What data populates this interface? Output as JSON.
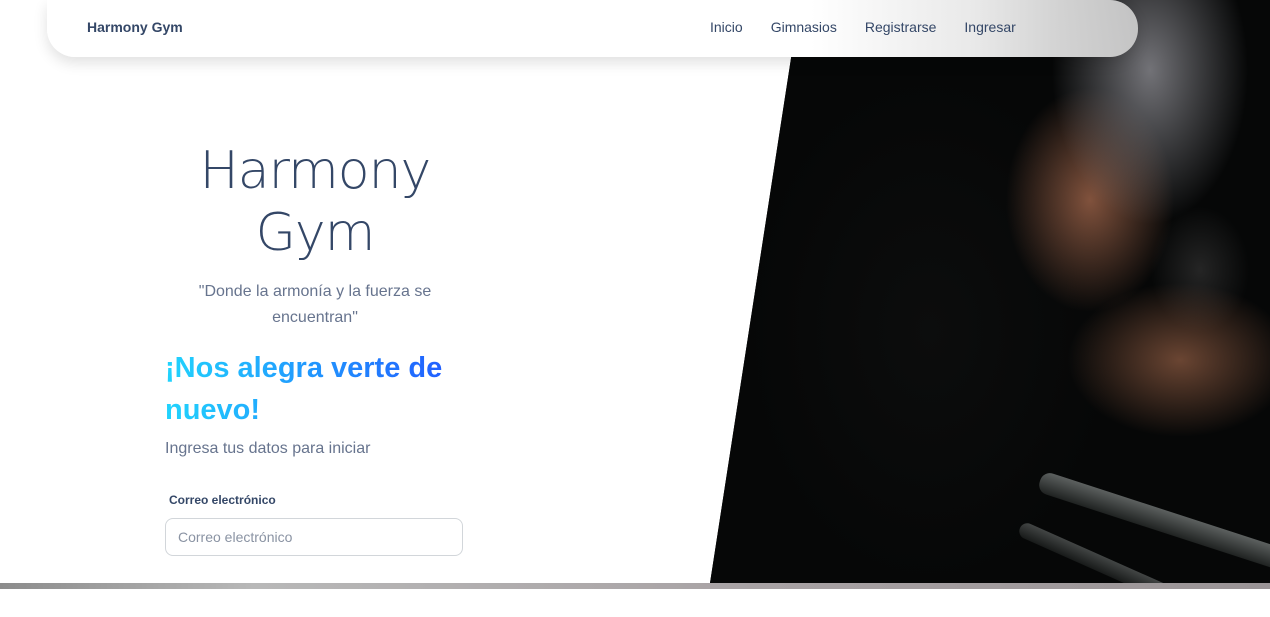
{
  "navbar": {
    "brand": "Harmony Gym",
    "links": [
      "Inicio",
      "Gimnasios",
      "Registrarse",
      "Ingresar"
    ]
  },
  "hero": {
    "title_line1": "Harmony",
    "title_line2": "Gym",
    "slogan_line1": "\"Donde la armonía y la fuerza se",
    "slogan_line2": "encuentran\""
  },
  "login": {
    "welcome_line1": "¡Nos alegra verte de",
    "welcome_line2": "nuevo!",
    "subtitle": "Ingresa tus datos para iniciar",
    "email_label": "Correo electrónico",
    "email_placeholder": "Correo electrónico",
    "email_value": ""
  },
  "colors": {
    "text_primary": "#344767",
    "text_secondary": "#67748e",
    "gradient_start": "#21d4fd",
    "gradient_end": "#2152ff"
  }
}
